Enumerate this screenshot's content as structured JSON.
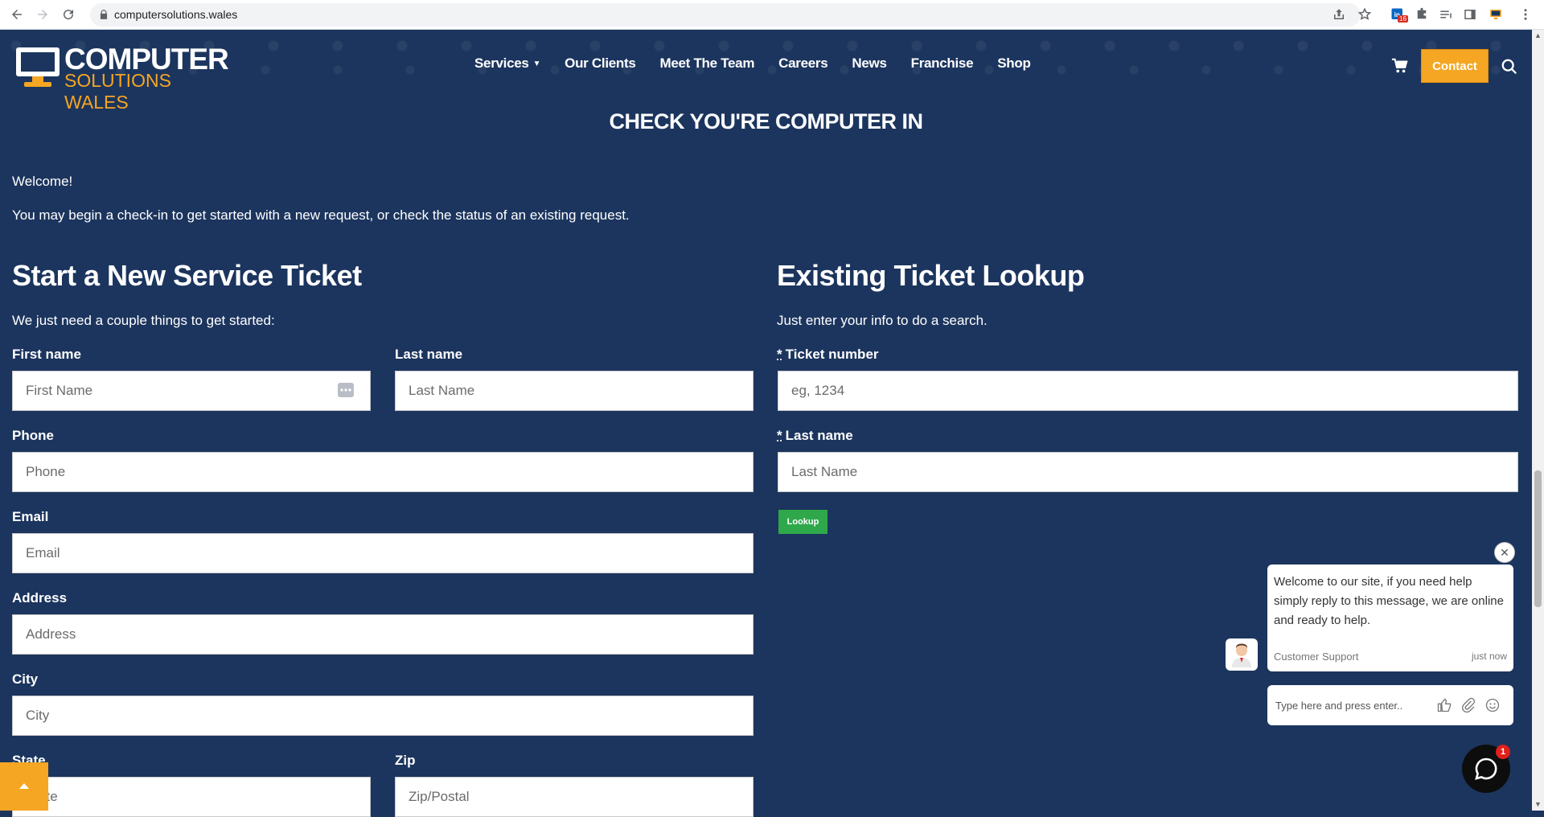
{
  "browser": {
    "url": "computersolutions.wales",
    "extension_badge": "16"
  },
  "header": {
    "logo_line1": "COMPUTER",
    "logo_line2": "SOLUTIONS WALES",
    "nav": [
      "Services",
      "Our Clients",
      "Meet The Team",
      "Careers",
      "News",
      "Franchise",
      "Shop"
    ],
    "contact_label": "Contact"
  },
  "page": {
    "title": "CHECK YOU'RE COMPUTER IN",
    "welcome": "Welcome!",
    "intro": "You may begin a check-in to get started with a new request, or check the status of an existing request."
  },
  "new_ticket": {
    "heading": "Start a New Service Ticket",
    "subheading": "We just need a couple things to get started:",
    "first_name_label": "First name",
    "first_name_placeholder": "First Name",
    "last_name_label": "Last name",
    "last_name_placeholder": "Last Name",
    "phone_label": "Phone",
    "phone_placeholder": "Phone",
    "email_label": "Email",
    "email_placeholder": "Email",
    "address_label": "Address",
    "address_placeholder": "Address",
    "city_label": "City",
    "city_placeholder": "City",
    "state_label": "State",
    "state_placeholder": "State",
    "zip_label": "Zip",
    "zip_placeholder": "Zip/Postal"
  },
  "lookup": {
    "heading": "Existing Ticket Lookup",
    "subheading": "Just enter your info to do a search.",
    "required_mark": "*",
    "ticket_label": "Ticket number",
    "ticket_placeholder": "eg, 1234",
    "last_name_label": "Last name",
    "last_name_placeholder": "Last Name",
    "button_label": "Lookup"
  },
  "chat": {
    "message": "Welcome to our site, if you need help simply reply to this message, we are online and ready to help.",
    "agent": "Customer Support",
    "time": "just now",
    "input_placeholder": "Type here and press enter..",
    "badge_count": "1"
  },
  "colors": {
    "background": "#1c355e",
    "accent_orange": "#f5a623",
    "lookup_green": "#2ea84b"
  }
}
